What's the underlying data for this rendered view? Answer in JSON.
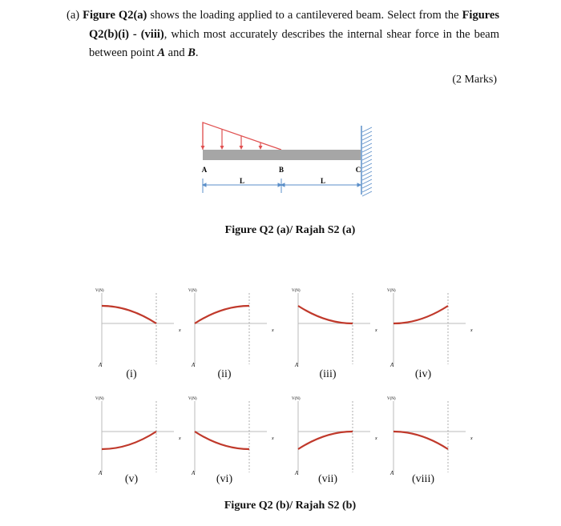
{
  "question": {
    "part": "(a)",
    "text_1": "Figure Q2(a)",
    "text_2": " shows the loading applied to a cantilevered beam. Select from the ",
    "text_3": "Figures Q2(b)(i) - (viii)",
    "text_4": ", which most accurately describes the internal shear force in the beam between point ",
    "point_a": "A",
    "and": " and ",
    "point_b": "B",
    "end": ".",
    "marks": "(2 Marks)"
  },
  "beam": {
    "labels": {
      "a": "A",
      "b": "B",
      "c": "C"
    },
    "span_labels": [
      "L",
      "L"
    ],
    "load_color": "#e05050",
    "dim_color": "#5b8fc9",
    "beam_color": "#a6a6a6",
    "caption": "Figure Q2 (a)/ Rajah S2 (a)"
  },
  "graphs": {
    "y_label": "V(N)",
    "x_label": "x",
    "origin_label": "A",
    "curve_color": "#c0392b",
    "items": [
      {
        "label": "(i)",
        "start": 1,
        "end": 0,
        "control": 1
      },
      {
        "label": "(ii)",
        "start": 0,
        "end": 1,
        "control": 1
      },
      {
        "label": "(iii)",
        "start": 1,
        "end": 0,
        "control": 0
      },
      {
        "label": "(iv)",
        "start": 0,
        "end": 1,
        "control": 0
      },
      {
        "label": "(v)",
        "start": -1,
        "end": 0,
        "control": -1
      },
      {
        "label": "(vi)",
        "start": 0,
        "end": -1,
        "control": -1
      },
      {
        "label": "(vii)",
        "start": -1,
        "end": 0,
        "control": 0
      },
      {
        "label": "(viii)",
        "start": 0,
        "end": -1,
        "control": 0
      }
    ],
    "caption": "Figure Q2 (b)/ Rajah S2 (b)"
  }
}
